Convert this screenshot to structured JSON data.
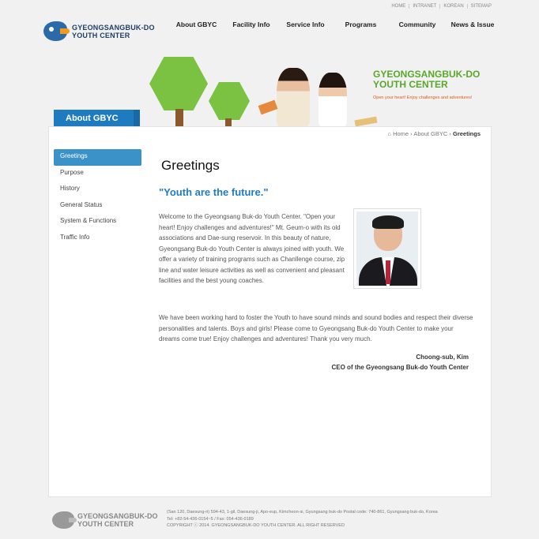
{
  "util_nav": [
    "HOME",
    "INTRANET",
    "KOREAN",
    "SITEMAP"
  ],
  "logo": {
    "line1": "GYEONGSANGBUK-DO",
    "line2": "YOUTH CENTER"
  },
  "gnb": [
    "About GBYC",
    "Facility Info",
    "Service Info",
    "Programs",
    "Community",
    "News & Issue"
  ],
  "visual": {
    "title1": "GYEONGSANGBUK-DO",
    "title2": "YOUTH CENTER",
    "subtitle": "Open your heart! Enjoy challenges and adventures!"
  },
  "sidebar": {
    "title": "About GBYC",
    "items": [
      "Greetings",
      "Purpose",
      "History",
      "General Status",
      "System & Functions",
      "Traffic Info"
    ],
    "active": 0
  },
  "breadcrumb": {
    "home": "Home",
    "section": "About GBYC",
    "current": "Greetings"
  },
  "main": {
    "title": "Greetings",
    "quote": "\"Youth are the future.\"",
    "paragraph1": "Welcome to the Gyeongsang Buk-do Youth Center. \"Open your heart! Enjoy challenges and adventures!\" Mt. Geum-o with its old associations and Dae-sung reservoir. In this beauty of nature, Gyeongsang Buk-do Youth Center is always joined with youth. We offer a variety of training programs such as Chanllenge course, zip line and water leisure activities as well as convenient and pleasant facilities and the best young coaches.",
    "paragraph2": "We have been working hard to foster the Youth to have sound minds and sound bodies and respect their diverse personalities and talents. Boys and girls! Please come to Gyeongsang Buk-do Youth Center to make your dreams come true! Enjoy challenges and adventures! Thank you very much.",
    "signature_name": "Choong-sub, Kim",
    "signature_title": "CEO of the Gyeongsang Buk-do Youth Center"
  },
  "footer": {
    "logo_line1": "GYEONGSANGBUK-DO",
    "logo_line2": "YOUTH CENTER",
    "address": "(San 120, Daesung-ri) 594-43, 1-gil, Daesung-ji, Apo-eup, Kimcheon-si, Gyungsang buk-do Postal code: 740-861, Gyungsang buk-do, Korea",
    "tel": "Tel: +82-54-436-0154~5 / Fax: 054-436-0189",
    "copyright": "COPYRIGHT ⓒ 2014. GYEONGSANGBUK-DO YOUTH CENTER. ALL RIGHT RESERVED"
  },
  "colors": {
    "accent": "#1e7bbf",
    "sidebar_active": "#3b92c9",
    "quote": "#1f7cc0",
    "visual_title": "#5aa72a",
    "visual_sub": "#e05a16"
  }
}
